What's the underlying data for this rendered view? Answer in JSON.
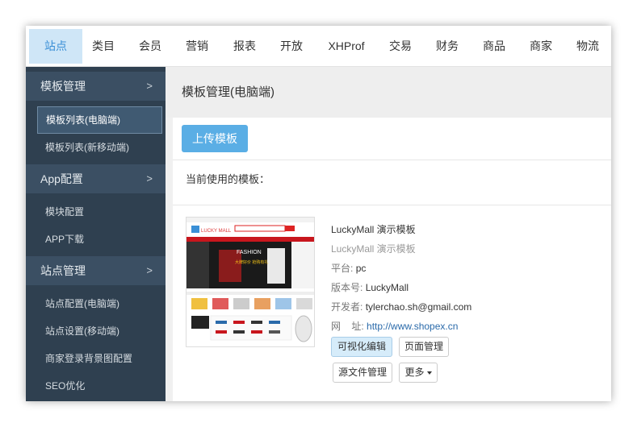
{
  "topnav": {
    "items": [
      "站点",
      "类目",
      "会员",
      "营销",
      "报表",
      "开放",
      "XHProf",
      "交易",
      "财务",
      "商品",
      "商家",
      "物流"
    ]
  },
  "sidebar": {
    "groups": [
      {
        "label": "模板管理",
        "items": [
          "模板列表(电脑端)",
          "模板列表(新移动端)"
        ]
      },
      {
        "label": "App配置",
        "items": [
          "模块配置",
          "APP下载"
        ]
      },
      {
        "label": "站点管理",
        "items": [
          "站点配置(电脑端)",
          "站点设置(移动端)",
          "商家登录背景图配置",
          "SEO优化"
        ]
      }
    ],
    "chevron": ">"
  },
  "content": {
    "title": "模板管理(电脑端)",
    "upload_button": "上传模板",
    "current_label": "当前使用的模板：",
    "template": {
      "name": "LuckyMall 演示模板",
      "description": "LuckyMall 演示模板",
      "platform_label": "平台:",
      "platform": "pc",
      "version_label": "版本号:",
      "version": "LuckyMall",
      "developer_label": "开发者:",
      "developer": "tylerchao.sh@gmail.com",
      "url_label": "网    址:",
      "url": "http://www.shopex.cn",
      "thumbnail": {
        "logo": "LUCKY MALL",
        "banner_text": "FASHION",
        "banner_sub": "大牌好价 抢购有礼"
      }
    },
    "buttons": {
      "visual_edit": "可视化编辑",
      "page_manage": "页面管理",
      "source_manage": "源文件管理",
      "more": "更多"
    }
  },
  "colors": {
    "sidebar_bg": "#2f4050",
    "sidebar_group_bg": "#3b4f63",
    "accent": "#5aaee5",
    "active_tab_bg": "#cfe6f7"
  }
}
